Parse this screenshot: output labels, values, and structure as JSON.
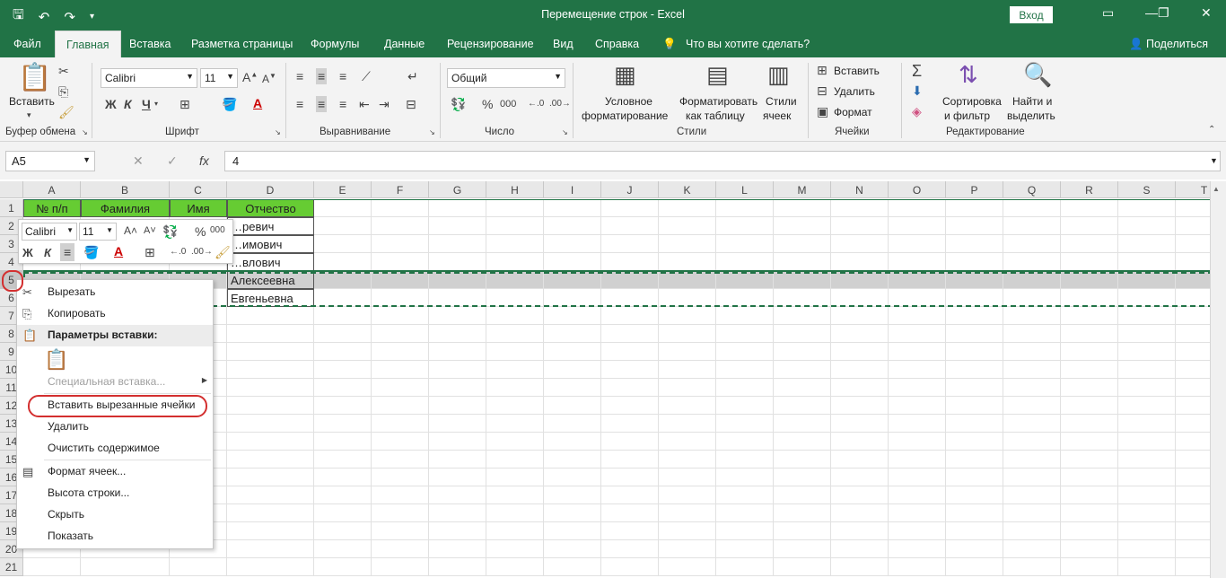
{
  "window": {
    "title": "Перемещение строк  -  Excel",
    "signin": "Вход"
  },
  "tabs": [
    "Файл",
    "Главная",
    "Вставка",
    "Разметка страницы",
    "Формулы",
    "Данные",
    "Рецензирование",
    "Вид",
    "Справка"
  ],
  "tell_me": "Что вы хотите сделать?",
  "share": "Поделиться",
  "ribbon": {
    "paste": "Вставить",
    "font_name": "Calibri",
    "font_size": "11",
    "bold": "Ж",
    "italic": "К",
    "underline": "Ч",
    "number_format": "Общий",
    "percent": "%",
    "thousands": "000",
    "cond_format_1": "Условное",
    "cond_format_2": "форматирование",
    "format_table_1": "Форматировать",
    "format_table_2": "как таблицу",
    "styles_1": "Стили",
    "styles_2": "ячеек",
    "insert": "Вставить",
    "delete": "Удалить",
    "format": "Формат",
    "sort_1": "Сортировка",
    "sort_2": "и фильтр",
    "find_1": "Найти и",
    "find_2": "выделить",
    "groups": [
      "Буфер обмена",
      "Шрифт",
      "Выравнивание",
      "Число",
      "Стили",
      "Ячейки",
      "Редактирование"
    ]
  },
  "formula_bar": {
    "name_box": "A5",
    "fx": "fx",
    "value": "4"
  },
  "columns": [
    "A",
    "B",
    "C",
    "D",
    "E",
    "F",
    "G",
    "H",
    "I",
    "J",
    "K",
    "L",
    "M",
    "N",
    "O",
    "P",
    "Q",
    "R",
    "S",
    "T"
  ],
  "rows": [
    "1",
    "2",
    "3",
    "4",
    "5",
    "6",
    "7",
    "8",
    "9",
    "10",
    "11",
    "12",
    "13",
    "14",
    "15",
    "16",
    "17",
    "18",
    "19",
    "20",
    "21"
  ],
  "table": {
    "headers": [
      "№ п/п",
      "Фамилия",
      "Имя",
      "Отчество"
    ],
    "d_values": [
      "…ревич",
      "…имович",
      "…влович",
      "Алексеевна",
      "Евгеньевна"
    ]
  },
  "mini_toolbar": {
    "font": "Calibri",
    "size": "11",
    "bold": "Ж",
    "italic": "К",
    "percent": "%",
    "thousands": "000"
  },
  "context_menu": {
    "cut": "Вырезать",
    "copy": "Копировать",
    "paste_options": "Параметры вставки:",
    "paste_special": "Специальная вставка...",
    "insert_cut": "Вставить вырезанные ячейки",
    "delete": "Удалить",
    "clear": "Очистить содержимое",
    "format_cells": "Формат ячеек...",
    "row_height": "Высота строки...",
    "hide": "Скрыть",
    "show": "Показать"
  },
  "colors": {
    "excel_green": "#217346",
    "header_fill": "#66cc33",
    "highlight_red": "#d32f2f"
  }
}
